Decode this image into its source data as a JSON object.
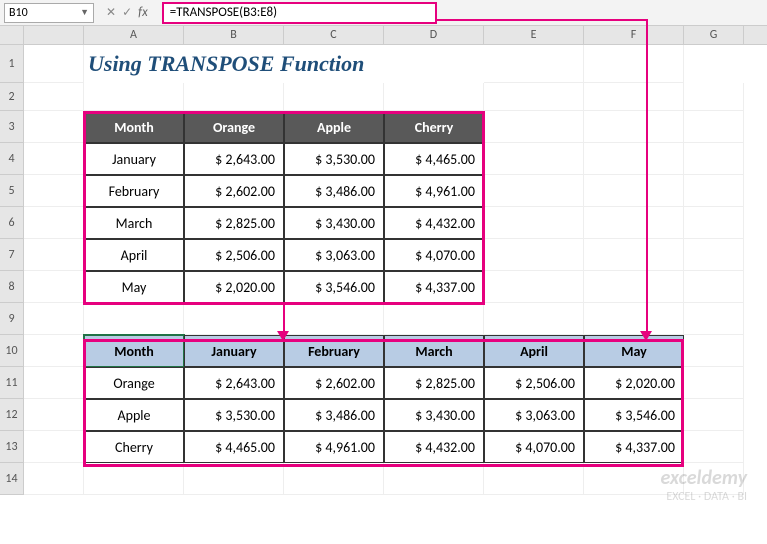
{
  "formula_bar": {
    "name_box": "B10",
    "fx": "fx",
    "formula": "=TRANSPOSE(B3:E8)"
  },
  "columns": [
    "",
    "",
    "A",
    "B",
    "C",
    "D",
    "E",
    "F",
    "G"
  ],
  "title": "Using TRANSPOSE Function",
  "source_table": {
    "headers": [
      "Month",
      "Orange",
      "Apple",
      "Cherry"
    ],
    "rows": [
      {
        "month": "January",
        "orange": "$   2,643.00",
        "apple": "$   3,530.00",
        "cherry": "$    4,465.00"
      },
      {
        "month": "February",
        "orange": "$   2,602.00",
        "apple": "$   3,486.00",
        "cherry": "$    4,961.00"
      },
      {
        "month": "March",
        "orange": "$   2,825.00",
        "apple": "$   3,430.00",
        "cherry": "$    4,432.00"
      },
      {
        "month": "April",
        "orange": "$   2,506.00",
        "apple": "$   3,063.00",
        "cherry": "$    4,070.00"
      },
      {
        "month": "May",
        "orange": "$   2,020.00",
        "apple": "$   3,546.00",
        "cherry": "$    4,337.00"
      }
    ]
  },
  "transposed_table": {
    "headers": [
      "Month",
      "January",
      "February",
      "March",
      "April",
      "May"
    ],
    "rows": [
      {
        "label": "Orange",
        "v": [
          "$   2,643.00",
          "$   2,602.00",
          "$    2,825.00",
          "$   2,506.00",
          "$ 2,020.00"
        ]
      },
      {
        "label": "Apple",
        "v": [
          "$   3,530.00",
          "$   3,486.00",
          "$    3,430.00",
          "$   3,063.00",
          "$ 3,546.00"
        ]
      },
      {
        "label": "Cherry",
        "v": [
          "$   4,465.00",
          "$   4,961.00",
          "$    4,432.00",
          "$   4,070.00",
          "$ 4,337.00"
        ]
      }
    ]
  },
  "row_numbers": [
    "1",
    "2",
    "3",
    "4",
    "5",
    "6",
    "7",
    "8",
    "9",
    "10",
    "11",
    "12",
    "13",
    "14"
  ],
  "watermark": {
    "main": "exceldemy",
    "sub": "EXCEL · DATA · BI"
  }
}
